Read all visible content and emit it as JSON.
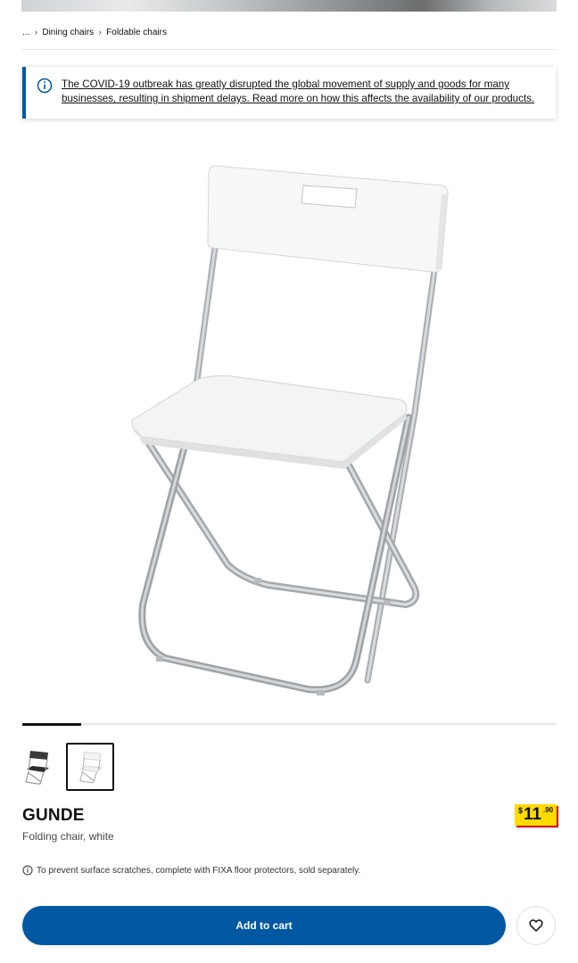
{
  "breadcrumb": {
    "ellipsis": "...",
    "items": [
      {
        "label": "Dining chairs"
      },
      {
        "label": "Foldable chairs"
      }
    ]
  },
  "notice": {
    "icon": "info-icon",
    "text": "The COVID-19 outbreak has greatly disrupted the global movement of supply and goods for many businesses, resulting in shipment delays. Read more on how this affects the availability of our products."
  },
  "gallery": {
    "progress_fraction": 0.11,
    "thumbnails": [
      {
        "name": "black-chair-thumbnail",
        "selected": false
      },
      {
        "name": "white-chair-thumbnail",
        "selected": true
      }
    ]
  },
  "product": {
    "name": "GUNDE",
    "description": "Folding chair, white",
    "price": {
      "currency": "$",
      "integer": "11",
      "decimal": ".90"
    },
    "tip": "To prevent surface scratches, complete with FIXA floor protectors, sold separately."
  },
  "actions": {
    "add_to_cart": "Add to cart",
    "favorite_icon": "heart-icon"
  },
  "colors": {
    "brand_blue": "#0058a3",
    "price_yellow": "#ffdb00",
    "price_red": "#cc0008"
  }
}
